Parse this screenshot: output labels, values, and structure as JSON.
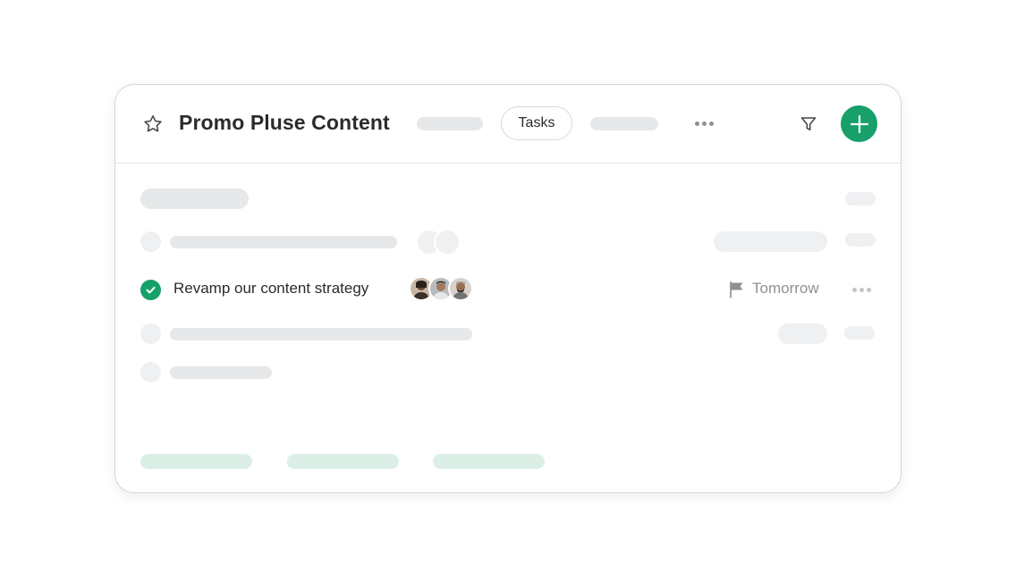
{
  "header": {
    "title": "Promo Pluse Content",
    "star_icon": "star-outline-icon",
    "tabs": [
      {
        "label": "Tasks",
        "active": true
      }
    ],
    "more_icon": "more-horizontal-icon",
    "filter_icon": "filter-icon",
    "add_icon": "plus-icon"
  },
  "task": {
    "name": "Revamp our content strategy",
    "completed": true,
    "assignee_count": 3,
    "due_date": "Tomorrow",
    "flag_icon": "flag-icon"
  },
  "colors": {
    "accent": "#17a06a",
    "placeholder": "#e6e8ea",
    "placeholder_light": "#eef0f2",
    "placeholder_green": "#dcefe6",
    "text_primary": "#2b2b2b",
    "text_muted": "#8d9096"
  }
}
